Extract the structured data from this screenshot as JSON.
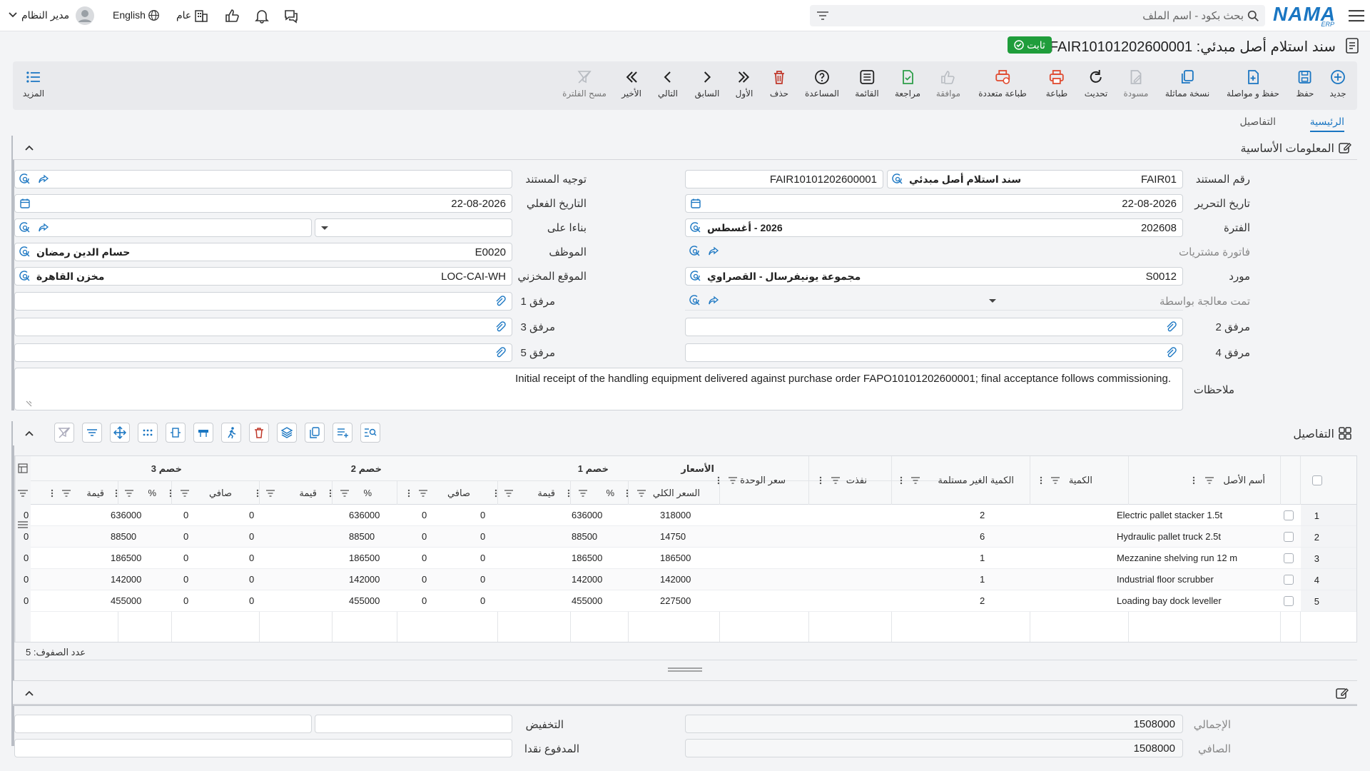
{
  "app": {
    "logo_text": "NAMA",
    "logo_sub": "ERP"
  },
  "topbar": {
    "search_placeholder": "بحث بكود - اسم الملف",
    "user_name": "مدير النظام",
    "language": "English",
    "scope": "عام"
  },
  "document": {
    "title": "سند استلام أصل مبدئي: FAIR10101202600001",
    "status": "ثابت"
  },
  "toolbar": {
    "items": [
      {
        "label": "جديد",
        "icon": "plus-circle-icon"
      },
      {
        "label": "حفظ",
        "icon": "save-icon"
      },
      {
        "label": "حفظ و مواصلة",
        "icon": "save-continue-icon"
      },
      {
        "label": "نسخة مماثلة",
        "icon": "copy-icon"
      },
      {
        "label": "مسودة",
        "icon": "draft-icon"
      },
      {
        "label": "تحديث",
        "icon": "refresh-icon"
      },
      {
        "label": "طباعة",
        "icon": "print-icon"
      },
      {
        "label": "طباعة متعددة",
        "icon": "multi-print-icon"
      },
      {
        "label": "موافقة",
        "icon": "thumbs-up-icon"
      },
      {
        "label": "مراجعة",
        "icon": "review-icon"
      },
      {
        "label": "القائمة",
        "icon": "list-icon"
      },
      {
        "label": "المساعدة",
        "icon": "help-icon"
      },
      {
        "label": "حذف",
        "icon": "trash-icon"
      },
      {
        "label": "الأول",
        "icon": "first-icon"
      },
      {
        "label": "السابق",
        "icon": "previous-icon"
      },
      {
        "label": "التالي",
        "icon": "next-icon"
      },
      {
        "label": "الأخير",
        "icon": "last-icon"
      },
      {
        "label": "مسح الفلترة",
        "icon": "clear-filter-icon"
      }
    ],
    "more_label": "المزيد"
  },
  "tabs": [
    {
      "label": "الرئيسية"
    },
    {
      "label": "التفاصيل"
    }
  ],
  "basic_info": {
    "section_title": "المعلومات الأساسية",
    "doc_number": {
      "label": "رقم المستند",
      "code": "FAIR01",
      "name": "سند استلام أصل مبدئي",
      "value": "FAIR10101202600001"
    },
    "doc_direction": {
      "label": "توجيه المستند",
      "value": ""
    },
    "edit_date": {
      "label": "تاريخ التحرير",
      "value": "22-08-2026"
    },
    "actual_date": {
      "label": "التاريخ الفعلي",
      "value": "22-08-2026"
    },
    "period": {
      "label": "الفترة",
      "code": "202608",
      "name": "2026 - أغسطس"
    },
    "based_on": {
      "label": "بناءا على",
      "value": ""
    },
    "purchase_invoice": {
      "label": "فاتورة مشتريات",
      "value": ""
    },
    "employee": {
      "label": "الموظف",
      "code": "E0020",
      "name": "حسام الدين رمضان"
    },
    "supplier": {
      "label": "مورد",
      "code": "S0012",
      "name": "مجموعة يونيفرسال - القصراوي"
    },
    "warehouse": {
      "label": "الموقع المخزني",
      "code": "LOC-CAI-WH",
      "name": "مخزن القاهرة"
    },
    "processed_by": {
      "label": "تمت معالجة بواسطة",
      "value": ""
    },
    "attachment1": {
      "label": "مرفق 1"
    },
    "attachment2": {
      "label": "مرفق 2"
    },
    "attachment3": {
      "label": "مرفق 3"
    },
    "attachment4": {
      "label": "مرفق 4"
    },
    "attachment5": {
      "label": "مرفق 5"
    },
    "notes": {
      "label": "ملاحظات",
      "value": "Initial receipt of the handling equipment delivered against purchase order FAPO10101202600001; final acceptance follows commissioning."
    }
  },
  "details": {
    "section_title": "التفاصيل",
    "group_headers": {
      "prices": "الأسعار",
      "discount1": "خصم 1",
      "discount2": "خصم 2",
      "discount3": "خصم 3"
    },
    "columns": {
      "asset_name": "أسم الأصل",
      "quantity": "الكمية",
      "unreceived_qty": "الكمية الغير مستلمة",
      "spent": "نفذت",
      "unit_price": "سعر الوحدة",
      "total_price": "السعر الكلي",
      "d1_pct": "%",
      "d1_value": "قيمة",
      "d1_net": "صافي",
      "d2_pct": "%",
      "d2_value": "قيمة",
      "d2_net": "صافي",
      "d3_pct": "%",
      "d3_value": "قيمة"
    },
    "rows": [
      {
        "no": "1",
        "asset_name": "Electric pallet stacker 1.5t",
        "quantity": "2",
        "unit_price": "318000",
        "total_price": "636000",
        "d1_pct": "0",
        "d1_value": "0",
        "d1_net": "636000",
        "d2_pct": "0",
        "d2_value": "0",
        "d2_net": "636000",
        "d3_pct": "0",
        "d3_value": "0"
      },
      {
        "no": "2",
        "asset_name": "Hydraulic pallet truck 2.5t",
        "quantity": "6",
        "unit_price": "14750",
        "total_price": "88500",
        "d1_pct": "0",
        "d1_value": "0",
        "d1_net": "88500",
        "d2_pct": "0",
        "d2_value": "0",
        "d2_net": "88500",
        "d3_pct": "0",
        "d3_value": "0"
      },
      {
        "no": "3",
        "asset_name": "Mezzanine shelving run 12 m",
        "quantity": "1",
        "unit_price": "186500",
        "total_price": "186500",
        "d1_pct": "0",
        "d1_value": "0",
        "d1_net": "186500",
        "d2_pct": "0",
        "d2_value": "0",
        "d2_net": "186500",
        "d3_pct": "0",
        "d3_value": "0"
      },
      {
        "no": "4",
        "asset_name": "Industrial floor scrubber",
        "quantity": "1",
        "unit_price": "142000",
        "total_price": "142000",
        "d1_pct": "0",
        "d1_value": "0",
        "d1_net": "142000",
        "d2_pct": "0",
        "d2_value": "0",
        "d2_net": "142000",
        "d3_pct": "0",
        "d3_value": "0"
      },
      {
        "no": "5",
        "asset_name": "Loading bay dock leveller",
        "quantity": "2",
        "unit_price": "227500",
        "total_price": "455000",
        "d1_pct": "0",
        "d1_value": "0",
        "d1_net": "455000",
        "d2_pct": "0",
        "d2_value": "0",
        "d2_net": "455000",
        "d3_pct": "0",
        "d3_value": "0"
      }
    ],
    "row_count": "عدد الصفوف: 5"
  },
  "totals": {
    "total_label": "الإجمالي",
    "total_value": "1508000",
    "discount_label": "التخفيض",
    "net_label": "الصافي",
    "net_value": "1508000",
    "cash_paid_label": "المدفوع نقدا"
  },
  "colors": {
    "accent": "#1a76c2",
    "status_green": "#1f9d3b",
    "danger": "#c0392b"
  }
}
